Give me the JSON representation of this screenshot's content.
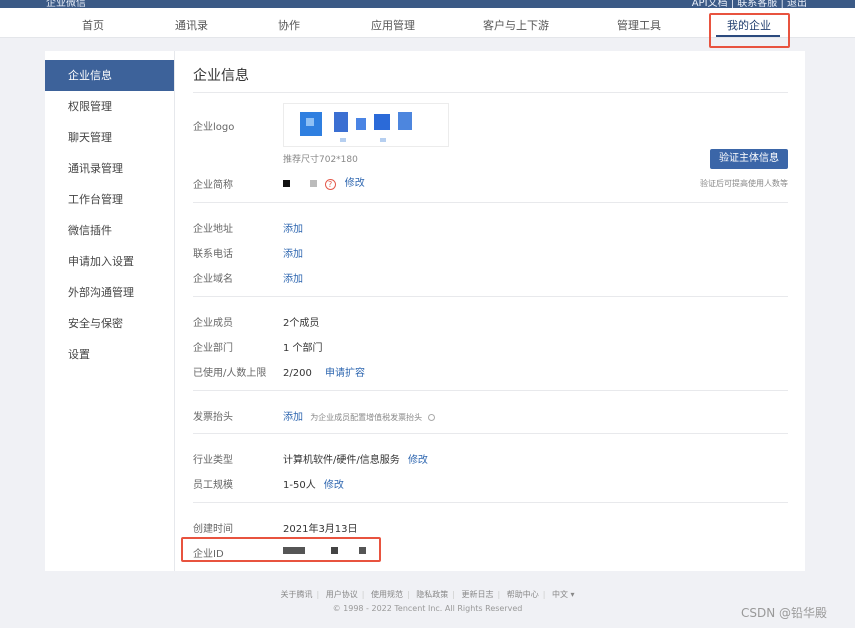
{
  "topbar": {
    "logo_text": "企业微信",
    "right_text": "API文档 | 联系客服 | 退出"
  },
  "nav": {
    "items": [
      "首页",
      "通讯录",
      "协作",
      "应用管理",
      "客户与上下游",
      "管理工具",
      "我的企业"
    ],
    "active": "我的企业"
  },
  "sidebar": {
    "items": [
      "企业信息",
      "权限管理",
      "聊天管理",
      "通讯录管理",
      "工作台管理",
      "微信插件",
      "申请加入设置",
      "外部沟通管理",
      "安全与保密",
      "设置"
    ],
    "active": "企业信息"
  },
  "page": {
    "title": "企业信息"
  },
  "logo_section": {
    "label": "企业logo",
    "size_hint": "推荐尺寸702*180"
  },
  "verify": {
    "button": "验证主体信息",
    "note": "验证后可提高使用人数等"
  },
  "short_name": {
    "label": "企业简称",
    "edit": "修改"
  },
  "contact": {
    "address_label": "企业地址",
    "address_action": "添加",
    "phone_label": "联系电话",
    "phone_action": "添加",
    "domain_label": "企业域名",
    "domain_action": "添加"
  },
  "stats": {
    "members_label": "企业成员",
    "members_value": "2个成员",
    "depts_label": "企业部门",
    "depts_value": "1 个部门",
    "usage_label": "已使用/人数上限",
    "usage_value": "2/200",
    "usage_action": "申请扩容"
  },
  "invoice": {
    "label": "发票抬头",
    "action": "添加",
    "hint": "为企业成员配置增值税发票抬头"
  },
  "industry": {
    "type_label": "行业类型",
    "type_value": "计算机软件/硬件/信息服务",
    "type_edit": "修改",
    "size_label": "员工规模",
    "size_value": "1-50人",
    "size_edit": "修改"
  },
  "meta": {
    "created_label": "创建时间",
    "created_value": "2021年3月13日",
    "id_label": "企业ID"
  },
  "footer": {
    "links": [
      "关于腾讯",
      "用户协议",
      "使用规范",
      "隐私政策",
      "更新日志",
      "帮助中心",
      "中文 ▾"
    ],
    "copyright": "© 1998 - 2022 Tencent Inc. All Rights Reserved"
  },
  "watermark": "CSDN @铅华殿",
  "colors": {
    "accent": "#3d629a",
    "link": "#2f67b0",
    "highlight": "#e8533f"
  }
}
